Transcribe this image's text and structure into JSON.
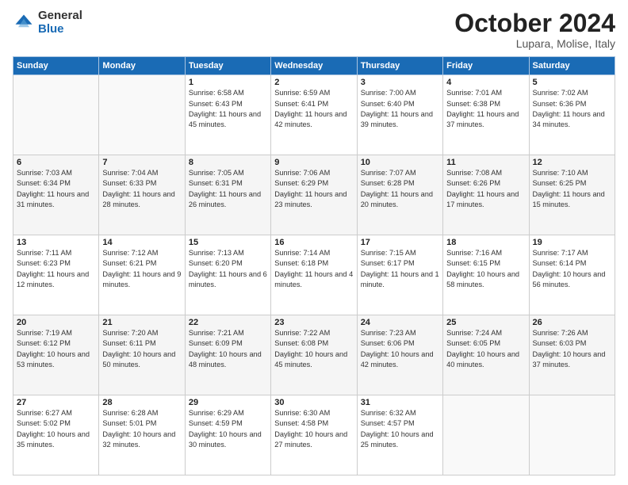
{
  "header": {
    "logo_general": "General",
    "logo_blue": "Blue",
    "month_title": "October 2024",
    "location": "Lupara, Molise, Italy"
  },
  "weekdays": [
    "Sunday",
    "Monday",
    "Tuesday",
    "Wednesday",
    "Thursday",
    "Friday",
    "Saturday"
  ],
  "weeks": [
    [
      {
        "day": "",
        "sunrise": "",
        "sunset": "",
        "daylight": ""
      },
      {
        "day": "",
        "sunrise": "",
        "sunset": "",
        "daylight": ""
      },
      {
        "day": "1",
        "sunrise": "Sunrise: 6:58 AM",
        "sunset": "Sunset: 6:43 PM",
        "daylight": "Daylight: 11 hours and 45 minutes."
      },
      {
        "day": "2",
        "sunrise": "Sunrise: 6:59 AM",
        "sunset": "Sunset: 6:41 PM",
        "daylight": "Daylight: 11 hours and 42 minutes."
      },
      {
        "day": "3",
        "sunrise": "Sunrise: 7:00 AM",
        "sunset": "Sunset: 6:40 PM",
        "daylight": "Daylight: 11 hours and 39 minutes."
      },
      {
        "day": "4",
        "sunrise": "Sunrise: 7:01 AM",
        "sunset": "Sunset: 6:38 PM",
        "daylight": "Daylight: 11 hours and 37 minutes."
      },
      {
        "day": "5",
        "sunrise": "Sunrise: 7:02 AM",
        "sunset": "Sunset: 6:36 PM",
        "daylight": "Daylight: 11 hours and 34 minutes."
      }
    ],
    [
      {
        "day": "6",
        "sunrise": "Sunrise: 7:03 AM",
        "sunset": "Sunset: 6:34 PM",
        "daylight": "Daylight: 11 hours and 31 minutes."
      },
      {
        "day": "7",
        "sunrise": "Sunrise: 7:04 AM",
        "sunset": "Sunset: 6:33 PM",
        "daylight": "Daylight: 11 hours and 28 minutes."
      },
      {
        "day": "8",
        "sunrise": "Sunrise: 7:05 AM",
        "sunset": "Sunset: 6:31 PM",
        "daylight": "Daylight: 11 hours and 26 minutes."
      },
      {
        "day": "9",
        "sunrise": "Sunrise: 7:06 AM",
        "sunset": "Sunset: 6:29 PM",
        "daylight": "Daylight: 11 hours and 23 minutes."
      },
      {
        "day": "10",
        "sunrise": "Sunrise: 7:07 AM",
        "sunset": "Sunset: 6:28 PM",
        "daylight": "Daylight: 11 hours and 20 minutes."
      },
      {
        "day": "11",
        "sunrise": "Sunrise: 7:08 AM",
        "sunset": "Sunset: 6:26 PM",
        "daylight": "Daylight: 11 hours and 17 minutes."
      },
      {
        "day": "12",
        "sunrise": "Sunrise: 7:10 AM",
        "sunset": "Sunset: 6:25 PM",
        "daylight": "Daylight: 11 hours and 15 minutes."
      }
    ],
    [
      {
        "day": "13",
        "sunrise": "Sunrise: 7:11 AM",
        "sunset": "Sunset: 6:23 PM",
        "daylight": "Daylight: 11 hours and 12 minutes."
      },
      {
        "day": "14",
        "sunrise": "Sunrise: 7:12 AM",
        "sunset": "Sunset: 6:21 PM",
        "daylight": "Daylight: 11 hours and 9 minutes."
      },
      {
        "day": "15",
        "sunrise": "Sunrise: 7:13 AM",
        "sunset": "Sunset: 6:20 PM",
        "daylight": "Daylight: 11 hours and 6 minutes."
      },
      {
        "day": "16",
        "sunrise": "Sunrise: 7:14 AM",
        "sunset": "Sunset: 6:18 PM",
        "daylight": "Daylight: 11 hours and 4 minutes."
      },
      {
        "day": "17",
        "sunrise": "Sunrise: 7:15 AM",
        "sunset": "Sunset: 6:17 PM",
        "daylight": "Daylight: 11 hours and 1 minute."
      },
      {
        "day": "18",
        "sunrise": "Sunrise: 7:16 AM",
        "sunset": "Sunset: 6:15 PM",
        "daylight": "Daylight: 10 hours and 58 minutes."
      },
      {
        "day": "19",
        "sunrise": "Sunrise: 7:17 AM",
        "sunset": "Sunset: 6:14 PM",
        "daylight": "Daylight: 10 hours and 56 minutes."
      }
    ],
    [
      {
        "day": "20",
        "sunrise": "Sunrise: 7:19 AM",
        "sunset": "Sunset: 6:12 PM",
        "daylight": "Daylight: 10 hours and 53 minutes."
      },
      {
        "day": "21",
        "sunrise": "Sunrise: 7:20 AM",
        "sunset": "Sunset: 6:11 PM",
        "daylight": "Daylight: 10 hours and 50 minutes."
      },
      {
        "day": "22",
        "sunrise": "Sunrise: 7:21 AM",
        "sunset": "Sunset: 6:09 PM",
        "daylight": "Daylight: 10 hours and 48 minutes."
      },
      {
        "day": "23",
        "sunrise": "Sunrise: 7:22 AM",
        "sunset": "Sunset: 6:08 PM",
        "daylight": "Daylight: 10 hours and 45 minutes."
      },
      {
        "day": "24",
        "sunrise": "Sunrise: 7:23 AM",
        "sunset": "Sunset: 6:06 PM",
        "daylight": "Daylight: 10 hours and 42 minutes."
      },
      {
        "day": "25",
        "sunrise": "Sunrise: 7:24 AM",
        "sunset": "Sunset: 6:05 PM",
        "daylight": "Daylight: 10 hours and 40 minutes."
      },
      {
        "day": "26",
        "sunrise": "Sunrise: 7:26 AM",
        "sunset": "Sunset: 6:03 PM",
        "daylight": "Daylight: 10 hours and 37 minutes."
      }
    ],
    [
      {
        "day": "27",
        "sunrise": "Sunrise: 6:27 AM",
        "sunset": "Sunset: 5:02 PM",
        "daylight": "Daylight: 10 hours and 35 minutes."
      },
      {
        "day": "28",
        "sunrise": "Sunrise: 6:28 AM",
        "sunset": "Sunset: 5:01 PM",
        "daylight": "Daylight: 10 hours and 32 minutes."
      },
      {
        "day": "29",
        "sunrise": "Sunrise: 6:29 AM",
        "sunset": "Sunset: 4:59 PM",
        "daylight": "Daylight: 10 hours and 30 minutes."
      },
      {
        "day": "30",
        "sunrise": "Sunrise: 6:30 AM",
        "sunset": "Sunset: 4:58 PM",
        "daylight": "Daylight: 10 hours and 27 minutes."
      },
      {
        "day": "31",
        "sunrise": "Sunrise: 6:32 AM",
        "sunset": "Sunset: 4:57 PM",
        "daylight": "Daylight: 10 hours and 25 minutes."
      },
      {
        "day": "",
        "sunrise": "",
        "sunset": "",
        "daylight": ""
      },
      {
        "day": "",
        "sunrise": "",
        "sunset": "",
        "daylight": ""
      }
    ]
  ]
}
